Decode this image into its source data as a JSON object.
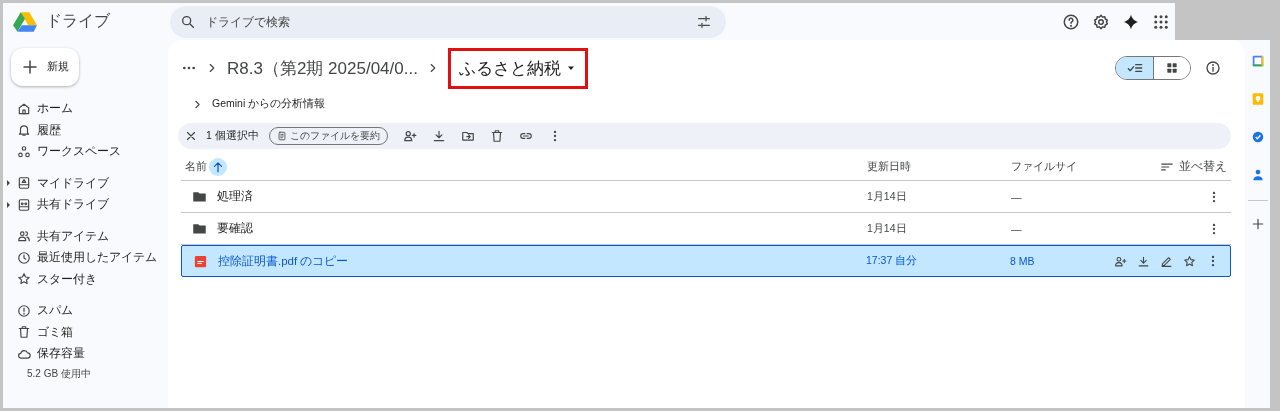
{
  "app": {
    "title": "ドライブ"
  },
  "search": {
    "placeholder": "ドライブで検索"
  },
  "new_button": "新規",
  "nav_groups": [
    [
      {
        "label": "ホーム",
        "expandable": false
      },
      {
        "label": "履歴",
        "expandable": false
      },
      {
        "label": "ワークスペース",
        "expandable": false
      }
    ],
    [
      {
        "label": "マイドライブ",
        "expandable": true
      },
      {
        "label": "共有ドライブ",
        "expandable": true
      }
    ],
    [
      {
        "label": "共有アイテム",
        "expandable": false
      },
      {
        "label": "最近使用したアイテム",
        "expandable": false
      },
      {
        "label": "スター付き",
        "expandable": false
      }
    ],
    [
      {
        "label": "スパム",
        "expandable": false
      },
      {
        "label": "ゴミ箱",
        "expandable": false
      },
      {
        "label": "保存容量",
        "expandable": false
      }
    ]
  ],
  "storage": "5.2 GB 使用中",
  "breadcrumb": {
    "items": [
      "R8.3（第2期 2025/04/0..."
    ],
    "current": "ふるさと納税",
    "annotated": true
  },
  "view_toggle": [
    {
      "kind": "list",
      "selected": true
    },
    {
      "kind": "grid",
      "selected": false
    }
  ],
  "gemini": "Gemini からの分析情報",
  "selection_bar": {
    "count": "1 個選択中",
    "summarize_button": "このファイルを要約"
  },
  "table": {
    "columns": [
      "名前",
      "更新日時",
      "ファイルサイ"
    ],
    "sort_label": "並べ替え",
    "rows": [
      {
        "kind": "folder",
        "name": "処理済",
        "modified": "1月14日",
        "size": "—",
        "selected": false
      },
      {
        "kind": "folder",
        "name": "要確認",
        "modified": "1月14日",
        "size": "—",
        "selected": false
      },
      {
        "kind": "pdf",
        "name": "控除証明書.pdf のコピー",
        "modified": "17:37 自分",
        "size": "8 MB",
        "selected": true
      }
    ]
  }
}
